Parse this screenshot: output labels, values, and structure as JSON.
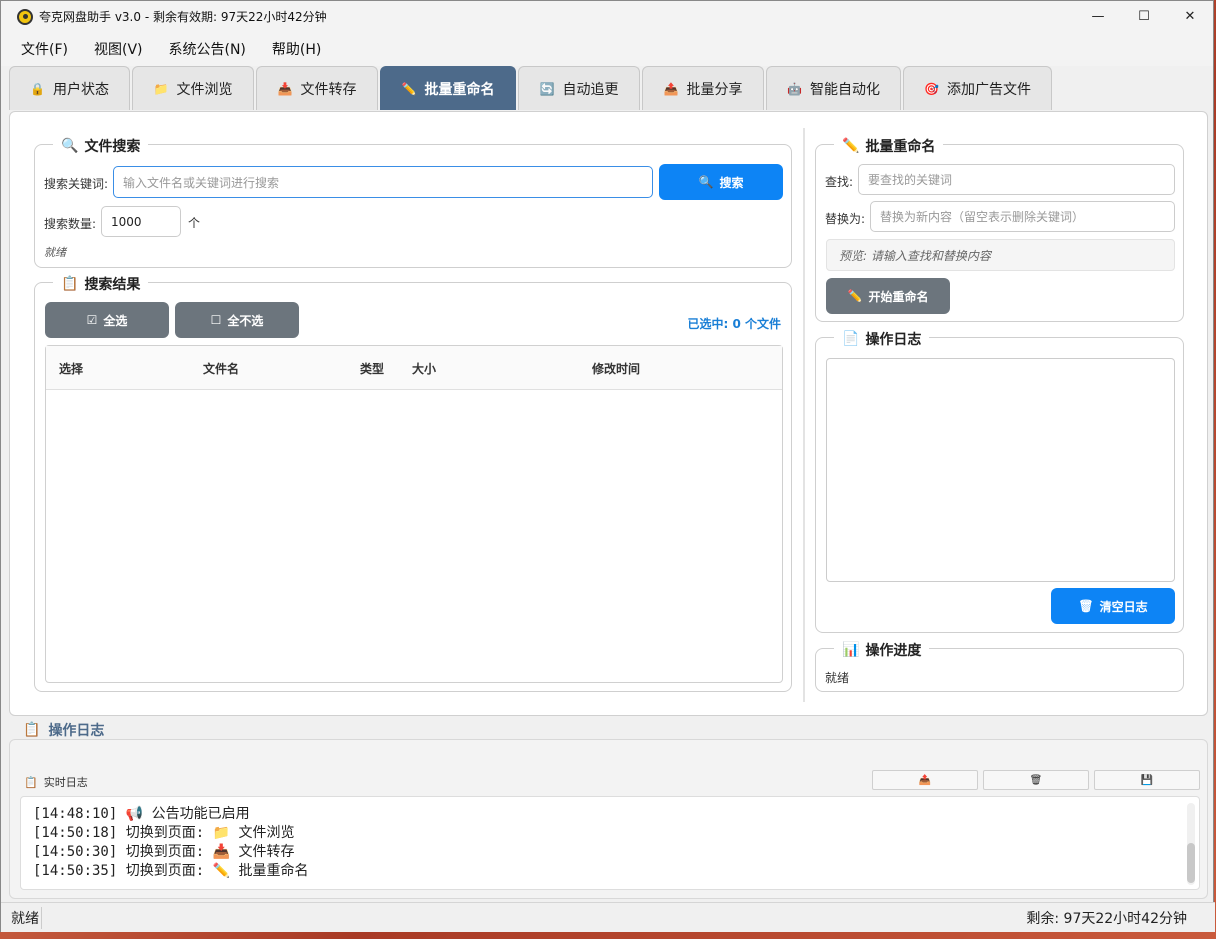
{
  "window": {
    "title": "夸克网盘助手 v3.0 - 剩余有效期: 97天22小时42分钟",
    "controls": {
      "minimize": "—",
      "maximize": "☐",
      "close": "✕"
    }
  },
  "menu": [
    "文件(F)",
    "视图(V)",
    "系统公告(N)",
    "帮助(H)"
  ],
  "tabs": [
    {
      "label": "用户状态",
      "icon": "🔒"
    },
    {
      "label": "文件浏览",
      "icon": "📁"
    },
    {
      "label": "文件转存",
      "icon": "📥"
    },
    {
      "label": "批量重命名",
      "icon": "✏️",
      "active": true
    },
    {
      "label": "自动追更",
      "icon": "🔄"
    },
    {
      "label": "批量分享",
      "icon": "📤"
    },
    {
      "label": "智能自动化",
      "icon": "🤖"
    },
    {
      "label": "添加广告文件",
      "icon": "🎯"
    }
  ],
  "search": {
    "title": "文件搜索",
    "keyword_label": "搜索关键词:",
    "keyword_placeholder": "输入文件名或关键词进行搜索",
    "search_button": "搜索",
    "count_label": "搜索数量:",
    "count_value": "1000",
    "count_unit": "个",
    "status": "就绪"
  },
  "results": {
    "title": "搜索结果",
    "select_all": "全选",
    "deselect_all": "全不选",
    "selected_info": "已选中: 0 个文件",
    "columns": [
      "选择",
      "文件名",
      "类型",
      "大小",
      "修改时间"
    ]
  },
  "rename": {
    "title": "批量重命名",
    "find_label": "查找:",
    "find_placeholder": "要查找的关键词",
    "replace_label": "替换为:",
    "replace_placeholder": "替换为新内容（留空表示删除关键词）",
    "preview": "预览: 请输入查找和替换内容",
    "start_button": "开始重命名"
  },
  "op_log": {
    "title": "操作日志",
    "clear_button": "清空日志"
  },
  "progress": {
    "title": "操作进度",
    "status": "就绪"
  },
  "bottom": {
    "section_title": "操作日志",
    "realtime_label": "实时日志",
    "logs": [
      {
        "time": "[14:48:10]",
        "icon": "📢",
        "text": "公告功能已启用"
      },
      {
        "time": "[14:50:18]",
        "icon": "📁",
        "text": "切换到页面: 📁 文件浏览"
      },
      {
        "time": "[14:50:30]",
        "icon": "📥",
        "text": "切换到页面: 📥 文件转存"
      },
      {
        "time": "[14:50:35]",
        "icon": "✏️",
        "text": "切换到页面: ✏️ 批量重命名"
      }
    ]
  },
  "statusbar": {
    "left": "就绪",
    "right": "剩余: 97天22小时42分钟"
  },
  "colors": {
    "accent": "#0d84f5",
    "active_tab": "#4d6a8a",
    "gray_button": "#6c757d",
    "info_text": "#1a7fd6"
  }
}
